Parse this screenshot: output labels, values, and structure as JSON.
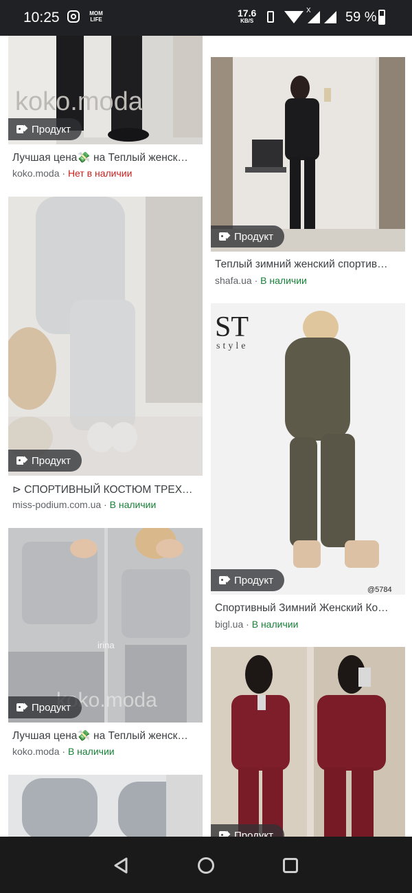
{
  "status": {
    "time": "10:25",
    "app_label_line1": "MOM",
    "app_label_line2": "LIFE",
    "speed_value": "17.6",
    "speed_unit": "KB/S",
    "network_mark": "X",
    "battery": "59 %"
  },
  "results": {
    "badge": "Продукт",
    "items": [
      {
        "title": "Лучшая цена💸 на Теплый женск…",
        "source": "koko.moda",
        "availability": "Нет в наличии",
        "status": "out",
        "watermark": "koko.moda"
      },
      {
        "title": "Теплый зимний женский спортив…",
        "source": "shafa.ua",
        "availability": "В наличии",
        "status": "in"
      },
      {
        "title": "⊳ СПОРТИВНЫЙ КОСТЮМ ТРЕХ…",
        "source": "miss-podium.com.ua",
        "availability": "В наличии",
        "status": "in"
      },
      {
        "title": "Спортивный Зимний Женский Ко…",
        "source": "bigl.ua",
        "availability": "В наличии",
        "status": "in",
        "logo_text": "ST",
        "logo_sub": "style",
        "photo_code": "@5784"
      },
      {
        "title": "Лучшая цена💸 на Теплый женск…",
        "source": "koko.moda",
        "availability": "В наличии",
        "status": "in",
        "photo_caption": "irina",
        "watermark": "koko.moda"
      },
      {
        "title": "",
        "source": "",
        "availability": ""
      },
      {
        "title": "",
        "source": "",
        "availability": ""
      }
    ]
  },
  "colors": {
    "in_stock": "#188038",
    "out_of_stock": "#c5221f",
    "status_bar": "#202124",
    "nav_bar": "#1a1a1a"
  }
}
